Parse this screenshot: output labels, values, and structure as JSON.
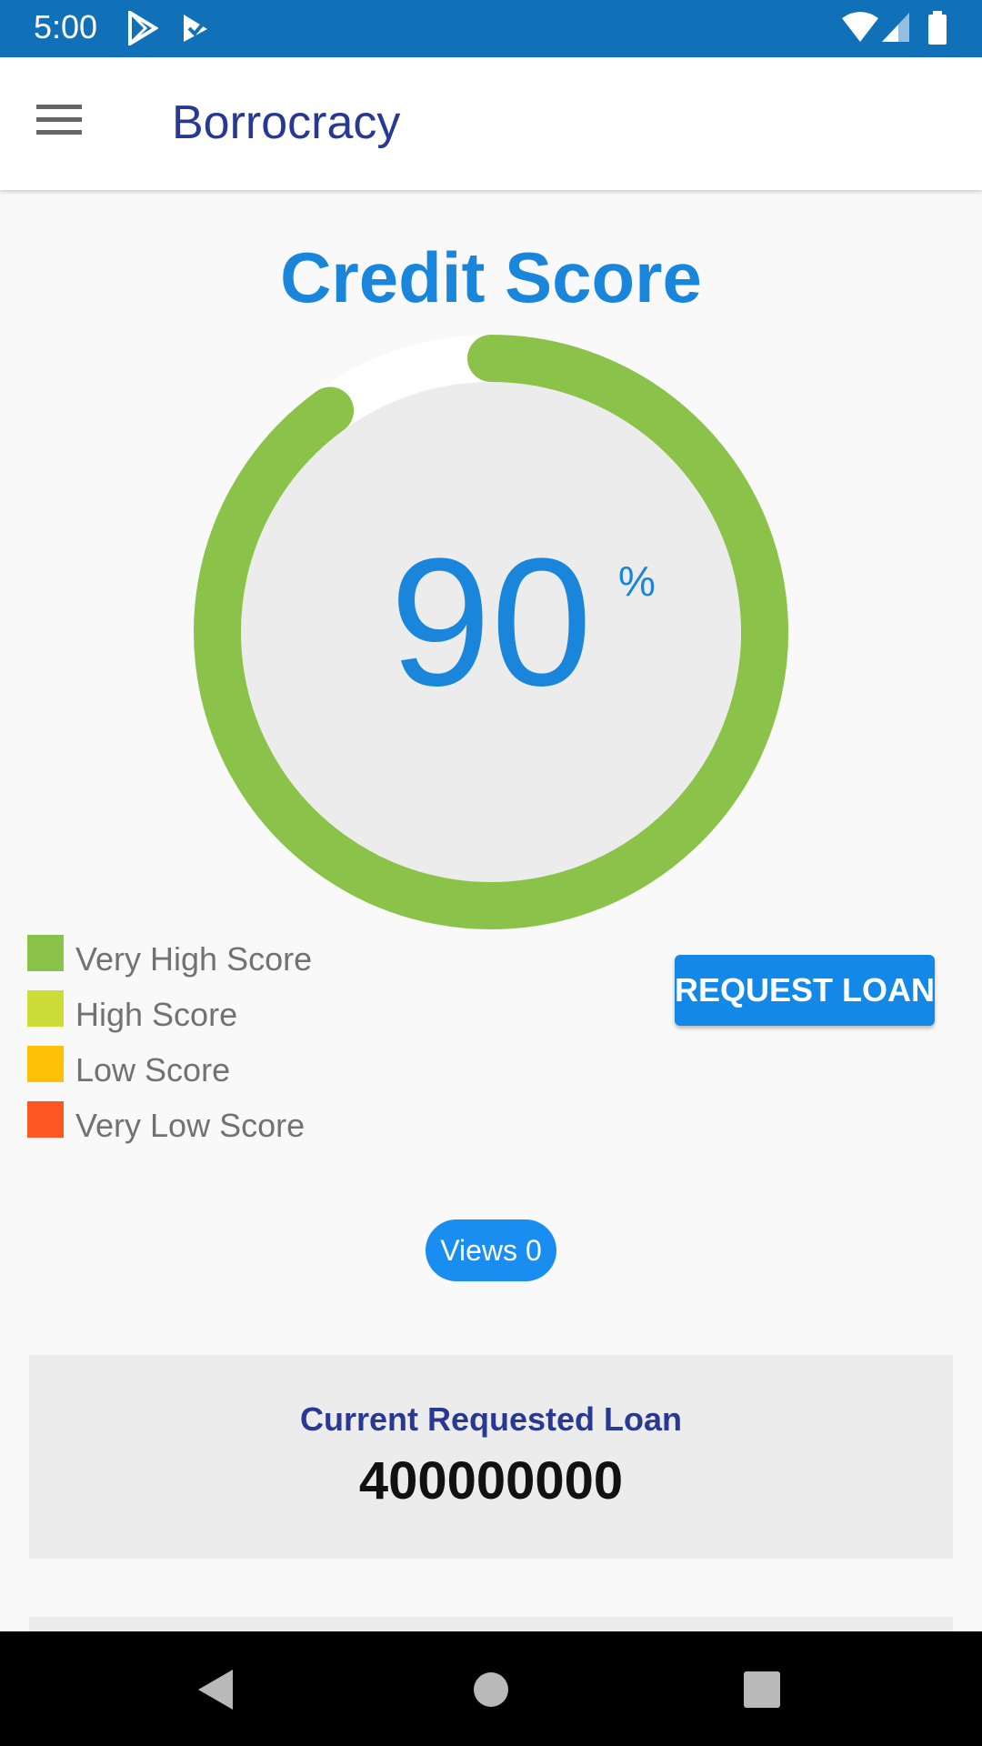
{
  "status_bar": {
    "time": "5:00",
    "icons": [
      "play-store-icon",
      "task-check-icon",
      "wifi-icon",
      "cell-signal-icon",
      "battery-icon"
    ],
    "background": "#1070b8"
  },
  "app_bar": {
    "menu_icon": "hamburger-menu-icon",
    "title": "Borrocracy",
    "title_color": "#293891"
  },
  "credit": {
    "title": "Credit Score",
    "score": "90",
    "unit": "%",
    "score_fraction": 0.9,
    "gauge_color": "#8bc34a",
    "accent_color": "#1a86db"
  },
  "legend": [
    {
      "label": "Very High Score",
      "color": "#8bc34a"
    },
    {
      "label": "High Score",
      "color": "#cddc39"
    },
    {
      "label": "Low Score",
      "color": "#ffc107"
    },
    {
      "label": "Very Low Score",
      "color": "#ff5722"
    }
  ],
  "request_button": {
    "label": "REQUEST LOAN"
  },
  "views": {
    "label": "Views 0"
  },
  "loan_card": {
    "label": "Current Requested Loan",
    "value": "400000000"
  },
  "nav_bar": {
    "icons": [
      "back-icon",
      "home-icon",
      "recents-icon"
    ]
  }
}
